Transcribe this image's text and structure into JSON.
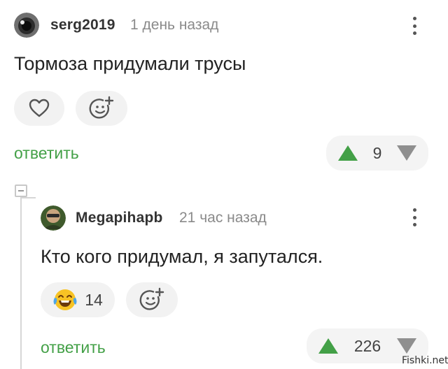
{
  "comment1": {
    "username": "serg2019",
    "timestamp": "1 день назад",
    "text": "Тормоза придумали трусы",
    "reply_label": "ответить",
    "score": "9",
    "icons": {
      "more": "more-vertical-icon",
      "like": "heart-icon",
      "reaction": "add-emoji-icon",
      "up": "triangle-up-icon",
      "down": "triangle-down-icon"
    }
  },
  "comment2": {
    "username": "Megapihapb",
    "timestamp": "21 час назад",
    "text": "Кто кого придумал, я запутался.",
    "reaction_count": "14",
    "reply_label": "ответить",
    "score": "226",
    "icons": {
      "more": "more-vertical-icon",
      "reaction_emoji": "laughing-with-tears-emoji-icon",
      "reaction": "add-emoji-icon",
      "up": "triangle-up-icon",
      "down": "triangle-down-icon"
    }
  },
  "watermark": "Fishki.net",
  "colors": {
    "accent_green": "#43a047",
    "pill_bg": "#f2f2f2",
    "vote_down": "#8f8f8f",
    "timestamp": "#8a8a8a"
  }
}
